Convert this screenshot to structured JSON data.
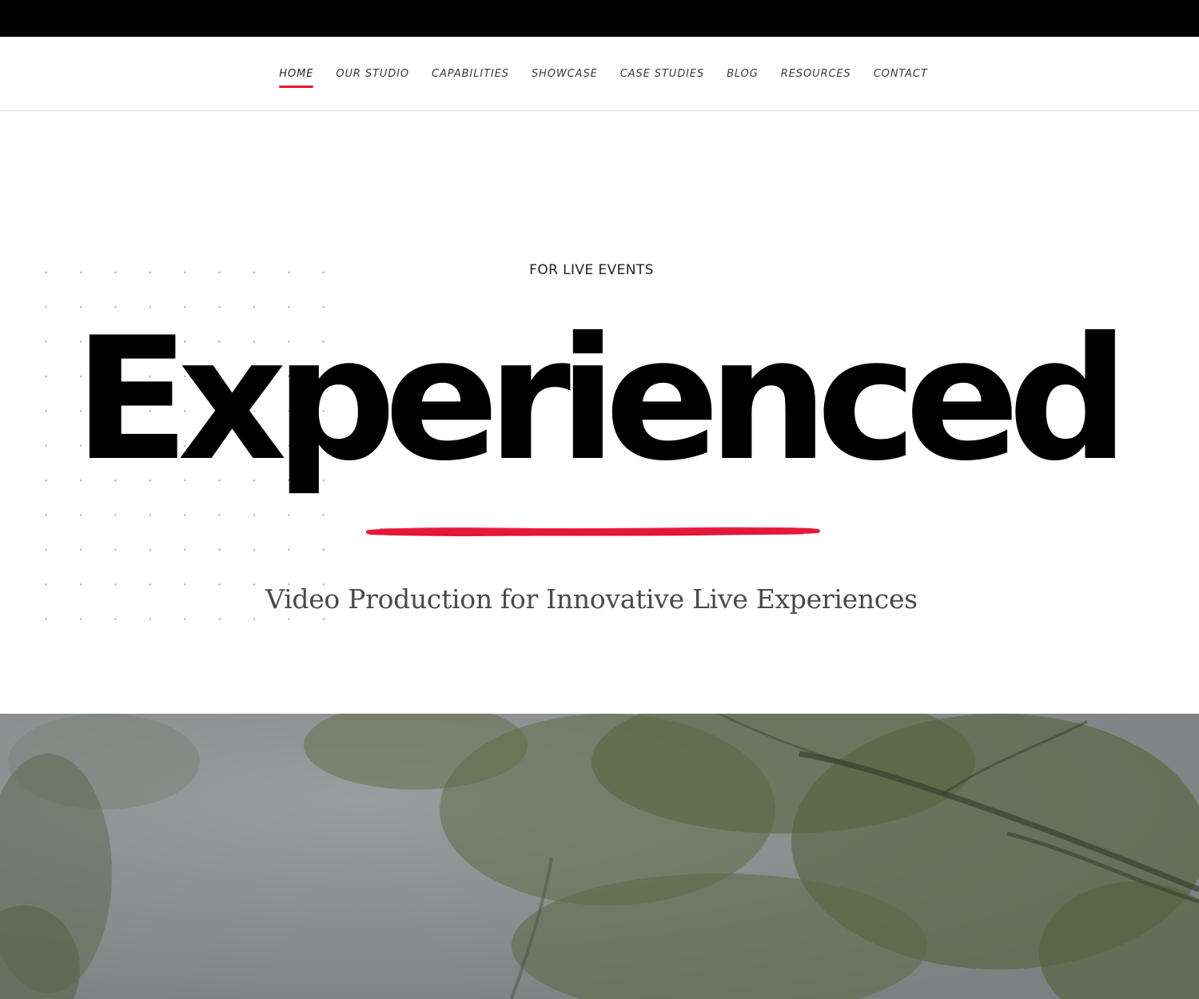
{
  "nav": {
    "items": [
      {
        "label": "HOME",
        "active": true
      },
      {
        "label": "OUR STUDIO",
        "active": false
      },
      {
        "label": "CAPABILITIES",
        "active": false
      },
      {
        "label": "SHOWCASE",
        "active": false
      },
      {
        "label": "CASE STUDIES",
        "active": false
      },
      {
        "label": "BLOG",
        "active": false
      },
      {
        "label": "RESOURCES",
        "active": false
      },
      {
        "label": "CONTACT",
        "active": false
      }
    ]
  },
  "hero": {
    "eyebrow": "FOR LIVE EVENTS",
    "title": "Experienced",
    "subtitle": "Video Production for Innovative Live Experiences"
  },
  "colors": {
    "accent": "#e5173a",
    "top_bar": "#000000",
    "title": "#000000",
    "subtitle": "#4a4a4a"
  },
  "media": {
    "icon": "tree-canopy-photo"
  }
}
